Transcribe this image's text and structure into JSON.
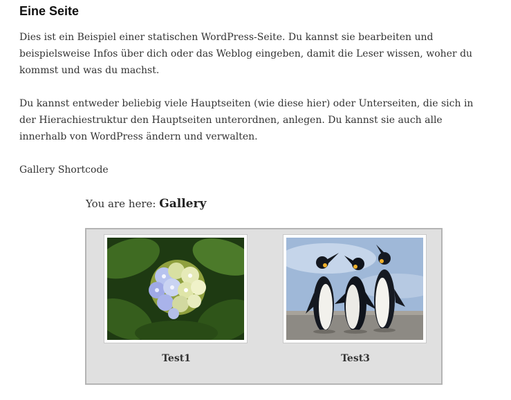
{
  "page": {
    "title": "Eine Seite",
    "paragraphs": [
      "Dies ist ein Beispiel einer statischen WordPress-Seite. Du kannst sie bearbeiten und beispielsweise Infos über dich oder das Weblog eingeben, damit die Leser wissen, woher du kommst und was du machst.",
      "Du kannst entweder beliebig viele Hauptseiten (wie diese hier) oder Unterseiten, die sich in der Hierachiestruktur den Hauptseiten unterordnen, anlegen. Du kannst sie auch alle innerhalb von WordPress ändern und verwalten.",
      "Gallery Shortcode"
    ]
  },
  "breadcrumb": {
    "prefix": "You are here: ",
    "current": "Gallery"
  },
  "gallery": {
    "background": "#e0e0e0",
    "items": [
      {
        "caption": "Test1",
        "image": "hydrangea-flower"
      },
      {
        "caption": "Test3",
        "image": "penguins"
      }
    ]
  }
}
